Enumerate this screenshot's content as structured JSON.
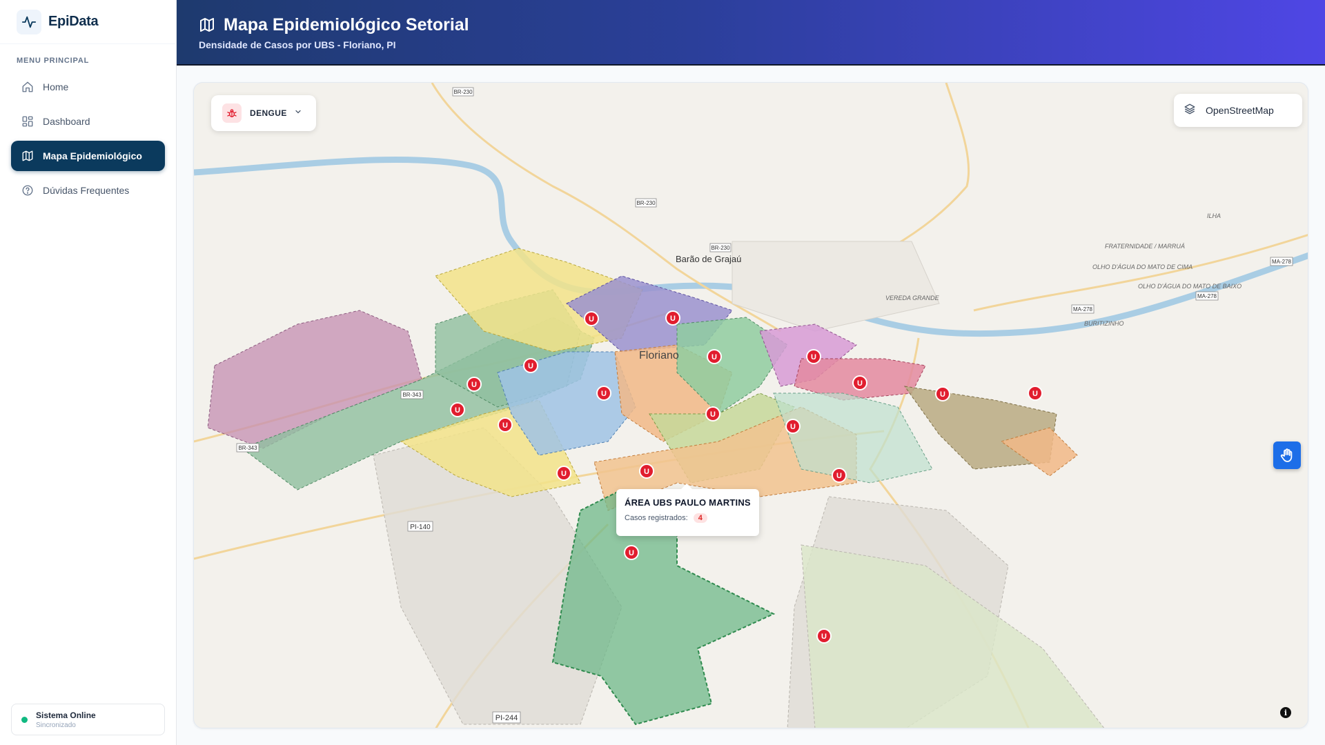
{
  "brand": {
    "name": "EpiData"
  },
  "sidebar": {
    "section_label": "MENU PRINCIPAL",
    "items": [
      {
        "label": "Home",
        "icon": "home-icon",
        "active": false
      },
      {
        "label": "Dashboard",
        "icon": "dashboard-grid-icon",
        "active": false
      },
      {
        "label": "Mapa Epidemiológico",
        "icon": "map-icon",
        "active": true
      },
      {
        "label": "Dúvidas Frequentes",
        "icon": "help-circle-icon",
        "active": false
      }
    ],
    "status": {
      "title": "Sistema Online",
      "subtitle": "Sincronizado",
      "color": "#10b981"
    }
  },
  "header": {
    "title": "Mapa Epidemiológico Setorial",
    "subtitle": "Densidade de Casos por UBS - Floriano, PI"
  },
  "map": {
    "disease_selector": {
      "value": "DENGUE",
      "icon": "bug-icon"
    },
    "layer_selector": {
      "value": "OpenStreetMap",
      "icon": "layers-icon"
    },
    "tooltip": {
      "title": "ÁREA UBS PAULO MARTINS",
      "cases_label": "Casos registrados:",
      "cases_value": "4"
    },
    "marker_label": "U",
    "city_labels": {
      "main": "Floriano",
      "neighbor": "Barão de Grajaú"
    },
    "place_labels": [
      "ILHA",
      "FRATERNIDADE / MARRUÁ",
      "OLHO D'ÁGUA DO MATO DE CIMA",
      "OLHO D'ÁGUA DO MATO DE BAIXO",
      "VEREDA GRANDE",
      "BURITIZINHO"
    ],
    "road_shields": [
      "BR-230",
      "BR-343",
      "PI-140",
      "PI-244",
      "MA-278"
    ],
    "accent_colors": {
      "marker": "#e11d2e",
      "header_start": "#1e3a6e",
      "header_end": "#4f46e5",
      "active_nav": "#0b3a5d"
    }
  }
}
